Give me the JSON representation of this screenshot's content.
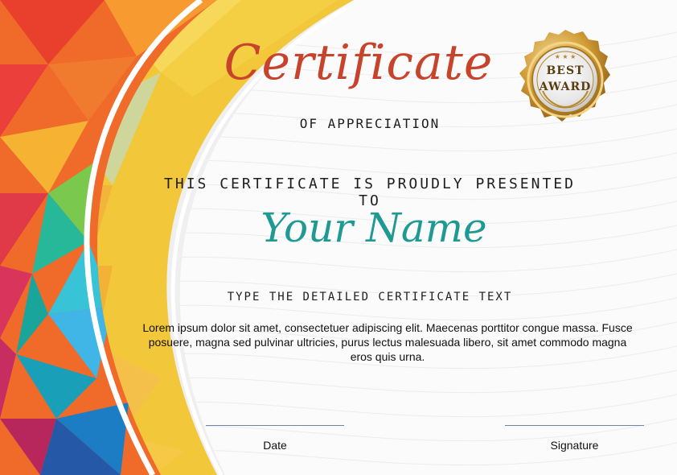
{
  "certificate": {
    "title": "Certificate",
    "subtitle": "OF APPRECIATION",
    "presented_line": "THIS CERTIFICATE IS PROUDLY PRESENTED TO",
    "recipient_name": "Your Name",
    "detail_heading": "TYPE THE DETAILED CERTIFICATE TEXT",
    "body_text": "Lorem ipsum dolor sit amet, consectetuer adipiscing elit. Maecenas porttitor congue massa. Fusce posuere, magna sed pulvinar ultricies, purus lectus malesuada libero, sit amet commodo magna eros quis urna.",
    "date_label": "Date",
    "signature_label": "Signature"
  },
  "badge": {
    "line1": "BEST",
    "line2": "AWARD"
  },
  "colors": {
    "title": "#c8432c",
    "name": "#1f9a93",
    "badge_gold": "#c9962e",
    "signature_line": "#6d86a6"
  }
}
